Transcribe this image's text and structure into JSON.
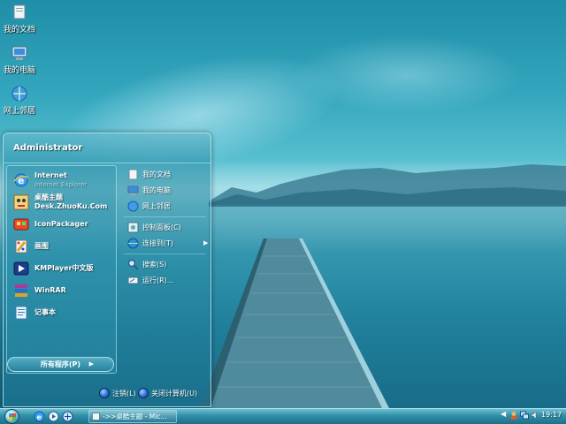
{
  "desktop": {
    "icons": [
      {
        "label": "我的文档",
        "icon": "my-documents-icon"
      },
      {
        "label": "我的电脑",
        "icon": "my-computer-icon"
      },
      {
        "label": "网上邻居",
        "icon": "network-places-icon"
      }
    ]
  },
  "start_menu": {
    "user": "Administrator",
    "programs": [
      {
        "label": "Internet",
        "sublabel": "Internet Explorer",
        "icon": "internet-explorer-icon"
      },
      {
        "label": "桌酷主题",
        "sublabel": "Desk.ZhuoKu.Com",
        "icon": "zhuoku-theme-icon"
      },
      {
        "label": "IconPackager",
        "icon": "iconpackager-icon"
      },
      {
        "label": "画图",
        "icon": "paint-icon"
      },
      {
        "label": "KMPlayer中文版",
        "icon": "kmplayer-icon"
      },
      {
        "label": "WinRAR",
        "icon": "winrar-icon"
      },
      {
        "label": "记事本",
        "icon": "notepad-icon"
      }
    ],
    "all_programs": "所有程序(P)",
    "places": [
      {
        "label": "我的文档",
        "icon": "my-documents-icon"
      },
      {
        "label": "我的电脑",
        "icon": "my-computer-icon"
      },
      {
        "label": "网上邻居",
        "icon": "network-places-icon"
      },
      {
        "label": "控制面板(C)",
        "icon": "control-panel-icon"
      },
      {
        "label": "连接到(T)",
        "icon": "connect-to-icon"
      },
      {
        "label": "搜索(S)",
        "icon": "search-icon"
      },
      {
        "label": "运行(R)...",
        "icon": "run-icon"
      }
    ],
    "logoff": "注销(L)",
    "shutdown": "关闭计算机(U)"
  },
  "taskbar": {
    "task_label": "->>桌酷主题 - Mic...",
    "clock": "19:17"
  }
}
